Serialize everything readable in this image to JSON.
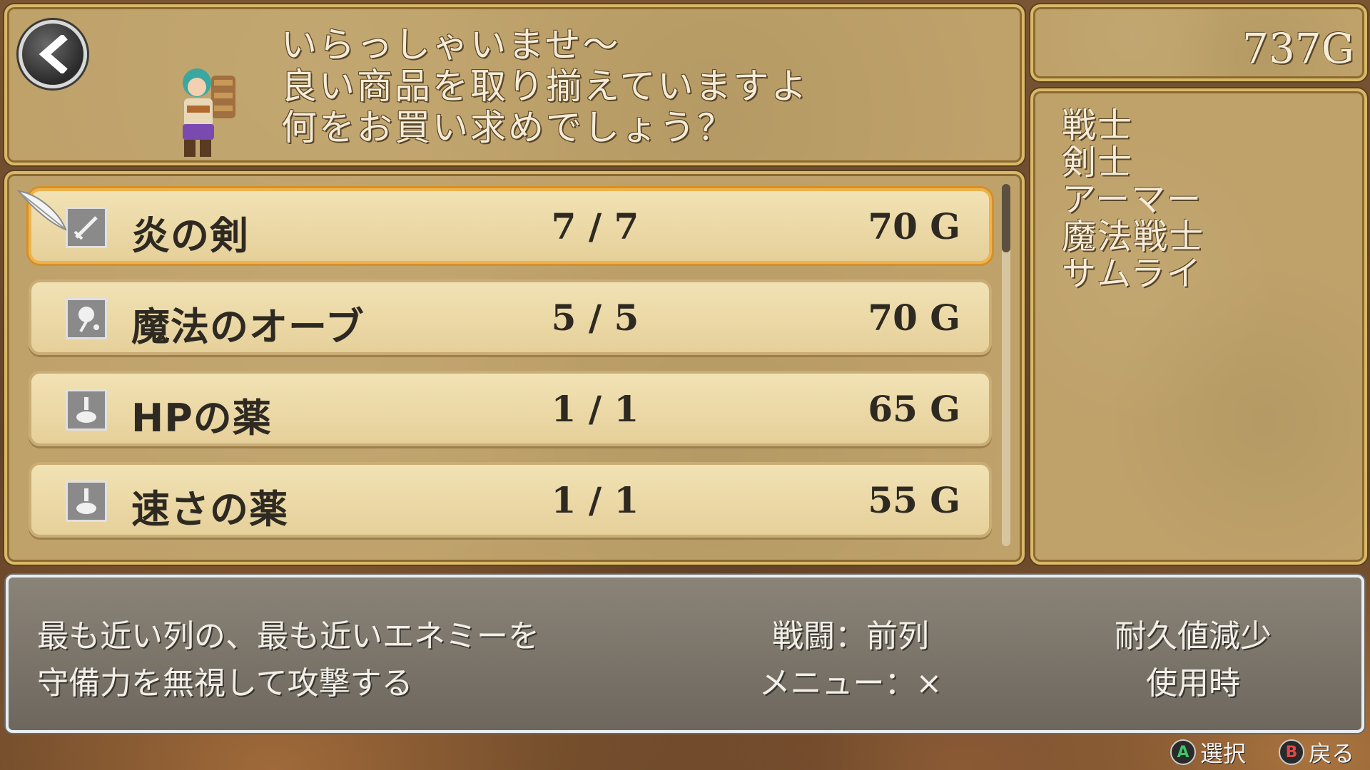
{
  "greeting": {
    "lines": [
      "いらっしゃいませ～",
      "良い商品を取り揃えていますよ",
      "何をお買い求めでしょう？"
    ]
  },
  "gold": "737G",
  "jobs": [
    "戦士",
    "剣士",
    "アーマー",
    "魔法戦士",
    "サムライ"
  ],
  "items": [
    {
      "name": "炎の剣",
      "stock": "7 / 7",
      "price": "70 G",
      "icon": "sword-icon",
      "selected": true
    },
    {
      "name": "魔法のオーブ",
      "stock": "5 / 5",
      "price": "70 G",
      "icon": "orb-icon",
      "selected": false
    },
    {
      "name": "HPの薬",
      "stock": "1 / 1",
      "price": "65 G",
      "icon": "potion-icon",
      "selected": false
    },
    {
      "name": "速さの薬",
      "stock": "1 / 1",
      "price": "55 G",
      "icon": "potion-icon",
      "selected": false
    }
  ],
  "description": {
    "lines": [
      "最も近い列の、最も近いエネミーを",
      "守備力を無視して攻撃する"
    ],
    "battle": "戦闘：前列",
    "menu": "メニュー：×",
    "durability": "耐久値減少",
    "usage": "使用時"
  },
  "hints": {
    "a_button": "A",
    "a_label": "選択",
    "b_button": "B",
    "b_label": "戻る"
  },
  "colors": {
    "panel": "#bfa26a",
    "row": "#f1e2b4",
    "selected_border": "#f0b24a",
    "a_button": "#3cc46a",
    "b_button": "#e04848"
  }
}
